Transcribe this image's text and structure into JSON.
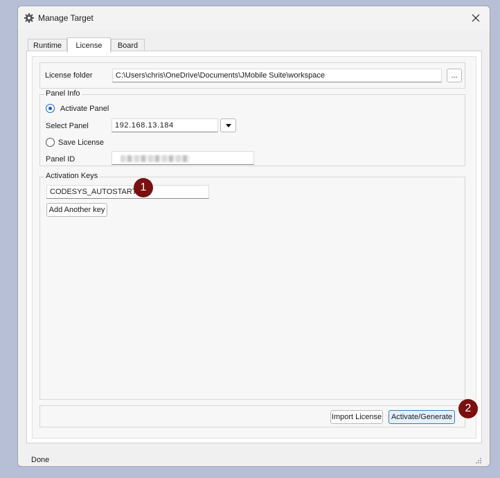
{
  "window": {
    "title": "Manage Target",
    "status": "Done"
  },
  "tabs": [
    {
      "label": "Runtime"
    },
    {
      "label": "License"
    },
    {
      "label": "Board"
    }
  ],
  "license": {
    "folder_label": "License folder",
    "folder_value": "C:\\Users\\chris\\OneDrive\\Documents\\JMobile Suite\\workspace",
    "browse_label": "..."
  },
  "panel_info": {
    "legend": "Panel Info",
    "activate_label": "Activate Panel",
    "activate_selected": true,
    "select_panel_label": "Select Panel",
    "select_panel_value": "192.168.13.184",
    "save_label": "Save License",
    "save_selected": false,
    "panel_id_label": "Panel ID"
  },
  "activation_keys": {
    "legend": "Activation Keys",
    "key_value": "CODESYS_AUTOSTART",
    "add_label": "Add Another key"
  },
  "actions": {
    "import_label": "Import License",
    "activate_label": "Activate/Generate"
  },
  "annotations": {
    "badge1": "1",
    "badge2": "2"
  },
  "colors": {
    "accent": "#1466c0",
    "badge": "#7a1010",
    "primary_button_border": "#3d7ab8"
  }
}
